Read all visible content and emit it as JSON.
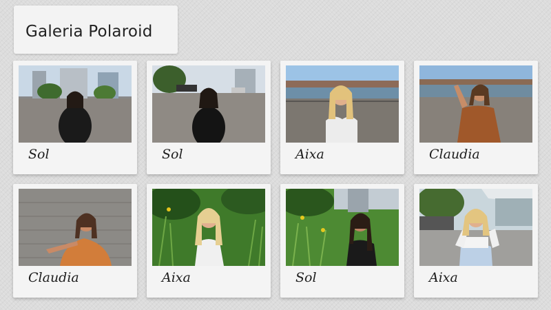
{
  "page": {
    "title": "Galeria Polaroid"
  },
  "gallery": {
    "items": [
      {
        "name": "Sol",
        "scene": "city-street"
      },
      {
        "name": "Sol",
        "scene": "city-street"
      },
      {
        "name": "Aixa",
        "scene": "waterfront"
      },
      {
        "name": "Claudia",
        "scene": "waterfront"
      },
      {
        "name": "Claudia",
        "scene": "cobblestone"
      },
      {
        "name": "Aixa",
        "scene": "tall-grass"
      },
      {
        "name": "Sol",
        "scene": "tall-grass"
      },
      {
        "name": "Aixa",
        "scene": "sidewalk"
      }
    ]
  }
}
